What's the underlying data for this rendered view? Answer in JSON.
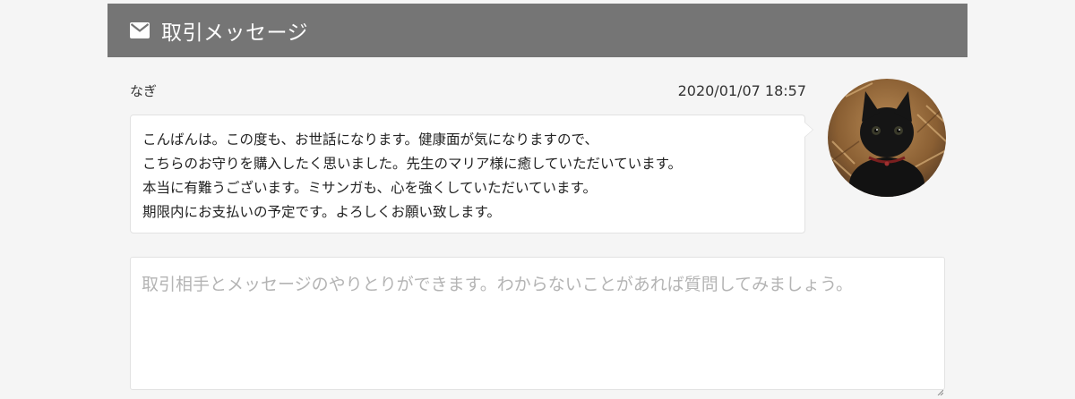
{
  "header": {
    "icon": "mail-icon",
    "title": "取引メッセージ"
  },
  "message": {
    "sender": "なぎ",
    "timestamp": "2020/01/07 18:57",
    "lines": [
      "こんばんは。この度も、お世話になります。健康面が気になりますので、",
      "こちらのお守りを購入したく思いました。先生のマリア様に癒していただいています。",
      "本当に有難うございます。ミサンガも、心を強くしていただいています。",
      "期限内にお支払いの予定です。よろしくお願い致します。"
    ],
    "avatar": "black-cat-photo"
  },
  "compose": {
    "value": "",
    "placeholder": "取引相手とメッセージのやりとりができます。わからないことがあれば質問してみましょう。"
  },
  "colors": {
    "page_background": "#f5f5f5",
    "header_background": "#757575",
    "header_text": "#ffffff",
    "bubble_background": "#ffffff",
    "border": "#e2e2e2",
    "placeholder_text": "#b4b4b4"
  }
}
